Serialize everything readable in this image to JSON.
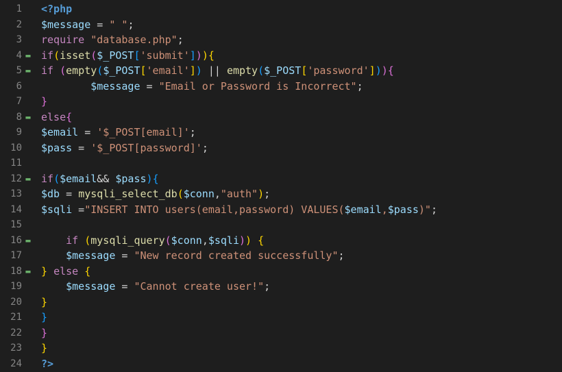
{
  "lines": [
    {
      "n": 1,
      "fold": false,
      "tokens": [
        [
          "tk-tag",
          "<?php"
        ]
      ]
    },
    {
      "n": 2,
      "fold": false,
      "tokens": [
        [
          "tk-var",
          "$message"
        ],
        [
          "tk-op",
          " = "
        ],
        [
          "tk-str",
          "\" \""
        ],
        [
          "tk-punc",
          ";"
        ]
      ]
    },
    {
      "n": 3,
      "fold": false,
      "tokens": [
        [
          "tk-kw",
          "require"
        ],
        [
          "tk-text",
          " "
        ],
        [
          "tk-str",
          "\"database.php\""
        ],
        [
          "tk-punc",
          ";"
        ]
      ]
    },
    {
      "n": 4,
      "fold": true,
      "tokens": [
        [
          "tk-kw",
          "if"
        ],
        [
          "tk-brace1",
          "("
        ],
        [
          "tk-func",
          "isset"
        ],
        [
          "tk-brace2",
          "("
        ],
        [
          "tk-var",
          "$_POST"
        ],
        [
          "tk-brace3",
          "["
        ],
        [
          "tk-str",
          "'submit'"
        ],
        [
          "tk-brace3",
          "]"
        ],
        [
          "tk-brace2",
          ")"
        ],
        [
          "tk-brace1",
          ")"
        ],
        [
          "tk-brace1",
          "{"
        ]
      ]
    },
    {
      "n": 5,
      "fold": true,
      "tokens": [
        [
          "tk-kw",
          "if"
        ],
        [
          "tk-text",
          " "
        ],
        [
          "tk-brace2",
          "("
        ],
        [
          "tk-func",
          "empty"
        ],
        [
          "tk-brace3",
          "("
        ],
        [
          "tk-var",
          "$_POST"
        ],
        [
          "tk-brace1",
          "["
        ],
        [
          "tk-str",
          "'email'"
        ],
        [
          "tk-brace1",
          "]"
        ],
        [
          "tk-brace3",
          ")"
        ],
        [
          "tk-text",
          " || "
        ],
        [
          "tk-func",
          "empty"
        ],
        [
          "tk-brace3",
          "("
        ],
        [
          "tk-var",
          "$_POST"
        ],
        [
          "tk-brace1",
          "["
        ],
        [
          "tk-str",
          "'password'"
        ],
        [
          "tk-brace1",
          "]"
        ],
        [
          "tk-brace3",
          ")"
        ],
        [
          "tk-brace2",
          ")"
        ],
        [
          "tk-brace2",
          "{"
        ]
      ]
    },
    {
      "n": 6,
      "fold": false,
      "tokens": [
        [
          "tk-text",
          "        "
        ],
        [
          "tk-var",
          "$message"
        ],
        [
          "tk-op",
          " = "
        ],
        [
          "tk-str",
          "\"Email or Password is Incorrect\""
        ],
        [
          "tk-punc",
          ";"
        ]
      ]
    },
    {
      "n": 7,
      "fold": false,
      "tokens": [
        [
          "tk-brace2",
          "}"
        ]
      ]
    },
    {
      "n": 8,
      "fold": true,
      "tokens": [
        [
          "tk-kw",
          "else"
        ],
        [
          "tk-brace2",
          "{"
        ]
      ]
    },
    {
      "n": 9,
      "fold": false,
      "tokens": [
        [
          "tk-var",
          "$email"
        ],
        [
          "tk-op",
          " = "
        ],
        [
          "tk-str",
          "'$_POST[email]'"
        ],
        [
          "tk-punc",
          ";"
        ]
      ]
    },
    {
      "n": 10,
      "fold": false,
      "tokens": [
        [
          "tk-var",
          "$pass"
        ],
        [
          "tk-op",
          " = "
        ],
        [
          "tk-str",
          "'$_POST[password]'"
        ],
        [
          "tk-punc",
          ";"
        ]
      ]
    },
    {
      "n": 11,
      "fold": false,
      "tokens": []
    },
    {
      "n": 12,
      "fold": true,
      "tokens": [
        [
          "tk-kw",
          "if"
        ],
        [
          "tk-brace3",
          "("
        ],
        [
          "tk-var",
          "$email"
        ],
        [
          "tk-op",
          "&& "
        ],
        [
          "tk-var",
          "$pass"
        ],
        [
          "tk-brace3",
          ")"
        ],
        [
          "tk-brace3",
          "{"
        ]
      ]
    },
    {
      "n": 13,
      "fold": false,
      "tokens": [
        [
          "tk-var",
          "$db"
        ],
        [
          "tk-op",
          " = "
        ],
        [
          "tk-func",
          "mysqli_select_db"
        ],
        [
          "tk-brace1",
          "("
        ],
        [
          "tk-var",
          "$conn"
        ],
        [
          "tk-punc",
          ","
        ],
        [
          "tk-str",
          "\"auth\""
        ],
        [
          "tk-brace1",
          ")"
        ],
        [
          "tk-punc",
          ";"
        ]
      ]
    },
    {
      "n": 14,
      "fold": false,
      "tokens": [
        [
          "tk-var",
          "$sqli"
        ],
        [
          "tk-op",
          " ="
        ],
        [
          "tk-str",
          "\"INSERT INTO users(email,password) VALUES("
        ],
        [
          "tk-var",
          "$email"
        ],
        [
          "tk-str",
          ","
        ],
        [
          "tk-var",
          "$pass"
        ],
        [
          "tk-str",
          ")\""
        ],
        [
          "tk-punc",
          ";"
        ]
      ]
    },
    {
      "n": 15,
      "fold": false,
      "tokens": []
    },
    {
      "n": 16,
      "fold": true,
      "tokens": [
        [
          "tk-text",
          "    "
        ],
        [
          "tk-kw",
          "if"
        ],
        [
          "tk-text",
          " "
        ],
        [
          "tk-brace1",
          "("
        ],
        [
          "tk-func",
          "mysqli_query"
        ],
        [
          "tk-brace2",
          "("
        ],
        [
          "tk-var",
          "$conn"
        ],
        [
          "tk-punc",
          ","
        ],
        [
          "tk-var",
          "$sqli"
        ],
        [
          "tk-brace2",
          ")"
        ],
        [
          "tk-brace1",
          ")"
        ],
        [
          "tk-text",
          " "
        ],
        [
          "tk-brace1",
          "{"
        ]
      ]
    },
    {
      "n": 17,
      "fold": false,
      "tokens": [
        [
          "tk-text",
          "    "
        ],
        [
          "tk-var",
          "$message"
        ],
        [
          "tk-op",
          " = "
        ],
        [
          "tk-str",
          "\"New record created successfully\""
        ],
        [
          "tk-punc",
          ";"
        ]
      ]
    },
    {
      "n": 18,
      "fold": true,
      "tokens": [
        [
          "tk-brace1",
          "}"
        ],
        [
          "tk-text",
          " "
        ],
        [
          "tk-kw",
          "else"
        ],
        [
          "tk-text",
          " "
        ],
        [
          "tk-brace1",
          "{"
        ]
      ]
    },
    {
      "n": 19,
      "fold": false,
      "tokens": [
        [
          "tk-text",
          "    "
        ],
        [
          "tk-var",
          "$message"
        ],
        [
          "tk-op",
          " = "
        ],
        [
          "tk-str",
          "\"Cannot create user!\""
        ],
        [
          "tk-punc",
          ";"
        ]
      ]
    },
    {
      "n": 20,
      "fold": false,
      "tokens": [
        [
          "tk-brace1",
          "}"
        ]
      ]
    },
    {
      "n": 21,
      "fold": false,
      "tokens": [
        [
          "tk-brace3",
          "}"
        ]
      ]
    },
    {
      "n": 22,
      "fold": false,
      "tokens": [
        [
          "tk-brace2",
          "}"
        ]
      ]
    },
    {
      "n": 23,
      "fold": false,
      "tokens": [
        [
          "tk-brace1",
          "}"
        ]
      ]
    },
    {
      "n": 24,
      "fold": false,
      "tokens": [
        [
          "tk-tag",
          "?>"
        ]
      ]
    }
  ],
  "foldGlyph": "▬"
}
